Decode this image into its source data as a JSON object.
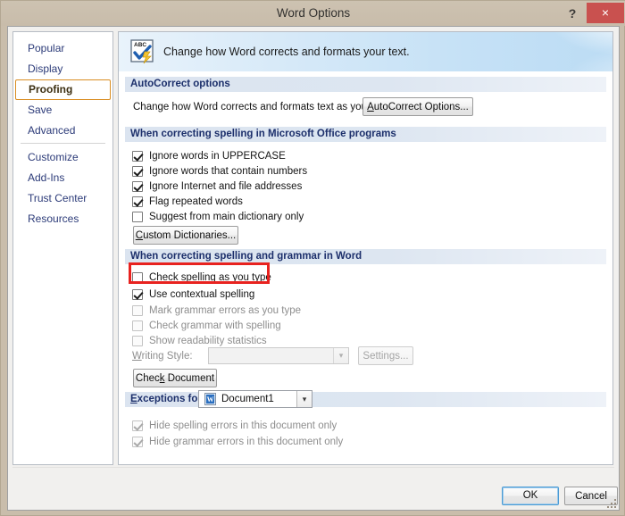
{
  "window": {
    "title": "Word Options",
    "help_label": "?",
    "close_label": "×",
    "help_icon": "question-mark-icon",
    "close_icon": "close-x-icon"
  },
  "sidebar": {
    "items": [
      {
        "label": "Popular",
        "selected": false
      },
      {
        "label": "Display",
        "selected": false
      },
      {
        "label": "Proofing",
        "selected": true
      },
      {
        "label": "Save",
        "selected": false
      },
      {
        "label": "Advanced",
        "selected": false
      },
      {
        "label": "Customize",
        "selected": false
      },
      {
        "label": "Add-Ins",
        "selected": false
      },
      {
        "label": "Trust Center",
        "selected": false
      },
      {
        "label": "Resources",
        "selected": false
      }
    ],
    "divider_after_index": 4,
    "selected_color": "#f59a26",
    "link_color": "#2b3a78"
  },
  "banner": {
    "icon": "abc-spellcheck-icon",
    "text": "Change how Word corrects and formats your text."
  },
  "sections": {
    "autocorrect": {
      "header": "AutoCorrect options",
      "description": "Change how Word corrects and formats text as you type:",
      "button": "AutoCorrect Options..."
    },
    "office_spelling": {
      "header": "When correcting spelling in Microsoft Office programs",
      "checkboxes": [
        {
          "label": "Ignore words in UPPERCASE",
          "checked": true,
          "enabled": true
        },
        {
          "label": "Ignore words that contain numbers",
          "checked": true,
          "enabled": true
        },
        {
          "label": "Ignore Internet and file addresses",
          "checked": true,
          "enabled": true
        },
        {
          "label": "Flag repeated words",
          "checked": true,
          "enabled": true
        },
        {
          "label": "Suggest from main dictionary only",
          "checked": false,
          "enabled": true
        }
      ],
      "button": "Custom Dictionaries..."
    },
    "word_spelling": {
      "header": "When correcting spelling and grammar in Word",
      "checkboxes": [
        {
          "label": "Check spelling as you type",
          "checked": false,
          "enabled": true,
          "highlighted": true
        },
        {
          "label": "Use contextual spelling",
          "checked": true,
          "enabled": true,
          "highlighted": false
        },
        {
          "label": "Mark grammar errors as you type",
          "checked": false,
          "enabled": false,
          "highlighted": false
        },
        {
          "label": "Check grammar with spelling",
          "checked": false,
          "enabled": false,
          "highlighted": false
        },
        {
          "label": "Show readability statistics",
          "checked": false,
          "enabled": false,
          "highlighted": false
        }
      ],
      "writing_style_label": "Writing Style:",
      "writing_style_value": "",
      "settings_button": "Settings...",
      "check_document_button": "Check Document"
    },
    "exceptions": {
      "header": "Exceptions for:",
      "document_icon": "word-document-icon",
      "document_value": "Document1",
      "checkboxes": [
        {
          "label": "Hide spelling errors in this document only",
          "checked": true,
          "enabled": false
        },
        {
          "label": "Hide grammar errors in this document only",
          "checked": true,
          "enabled": false
        }
      ]
    }
  },
  "footer": {
    "ok_label": "OK",
    "cancel_label": "Cancel"
  },
  "annotation": {
    "color": "#e8221f",
    "target": "Check spelling as you type"
  }
}
